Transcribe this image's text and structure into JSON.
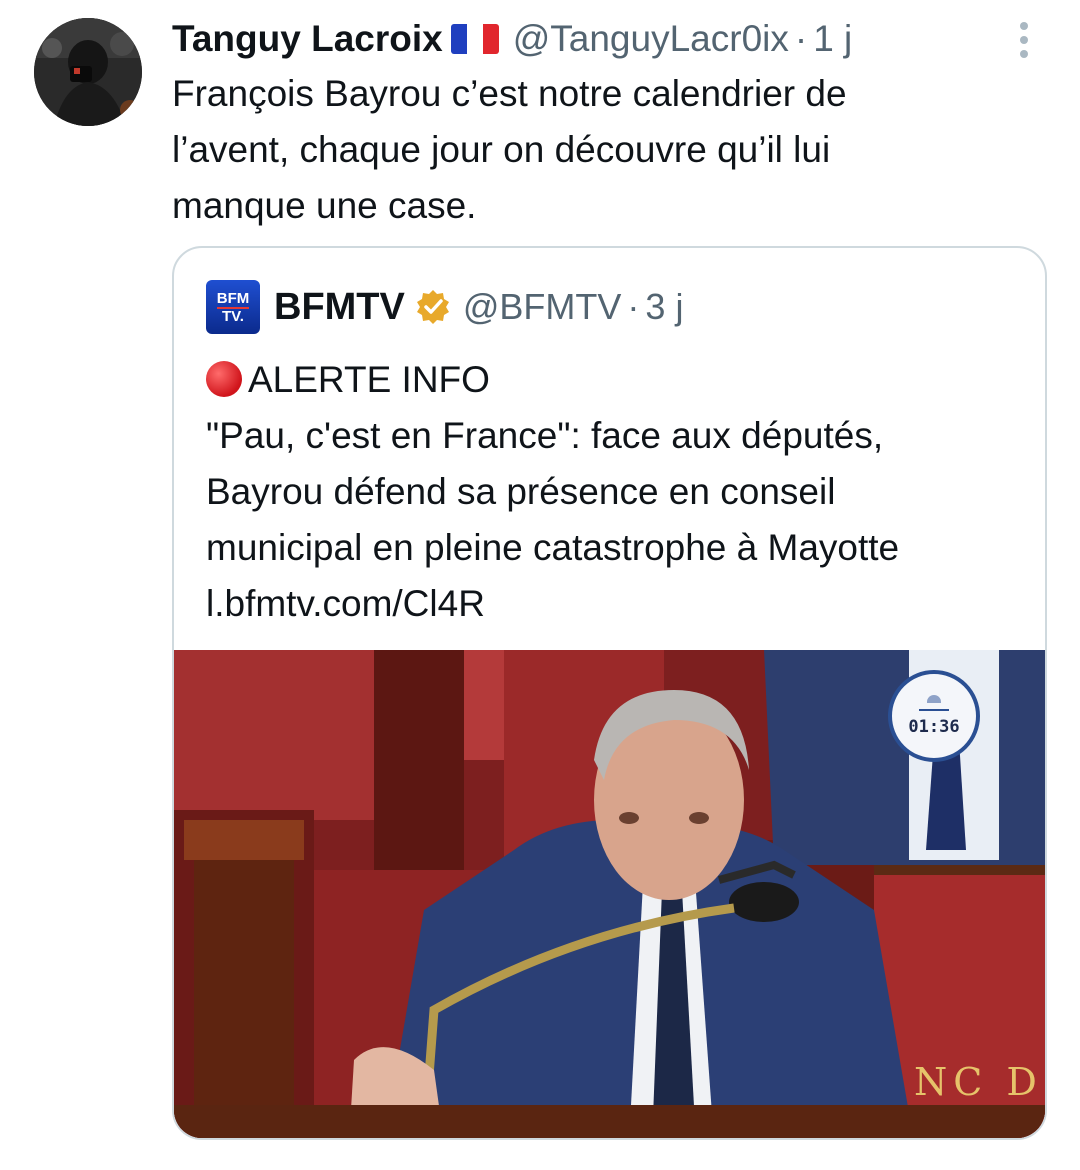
{
  "tweet": {
    "author_name": "Tanguy Lacroix",
    "flag_icon": "france-flag-icon",
    "handle": "@TanguyLacr0ix",
    "separator": "·",
    "time": "1 j",
    "more_icon": "more-vertical-icon",
    "text_lines": [
      "François Bayrou c’est notre calendrier de",
      "l’avent, chaque jour on découvre qu’il lui",
      "manque une case."
    ]
  },
  "quote": {
    "logo_top": "BFM",
    "logo_bottom": "TV.",
    "author_name": "BFMTV",
    "verified_icon": "verified-gold-badge-icon",
    "handle": "@BFMTV",
    "separator": "·",
    "time": "3 j",
    "alert_icon": "red-circle-icon",
    "alert_label": "ALERTE INFO",
    "text_lines": [
      "\"Pau, c'est en France\": face aux députés,",
      "Bayrou défend sa présence en conseil",
      "municipal en pleine catastrophe à Mayotte",
      "l.bfmtv.com/Cl4R"
    ],
    "media": {
      "timer": "01:36",
      "bench_text": "NC D"
    }
  },
  "colors": {
    "text": "#0f1419",
    "secondary": "#536471",
    "border": "#cfd9de",
    "verified": "#e8a92b",
    "alert": "#d0141b"
  }
}
